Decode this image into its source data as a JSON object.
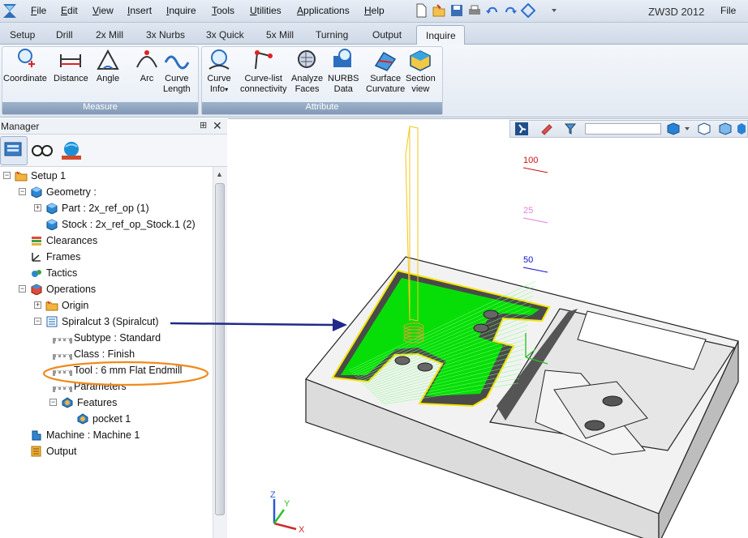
{
  "menubar": {
    "items": [
      {
        "label": "File",
        "u": "F",
        "rest": "ile"
      },
      {
        "label": "Edit",
        "u": "E",
        "rest": "dit"
      },
      {
        "label": "View",
        "u": "V",
        "rest": "iew"
      },
      {
        "label": "Insert",
        "u": "I",
        "rest": "nsert"
      },
      {
        "label": "Inquire",
        "u": "I",
        "rest": "nquire"
      },
      {
        "label": "Tools",
        "u": "T",
        "rest": "ools"
      },
      {
        "label": "Utilities",
        "u": "U",
        "rest": "tilities"
      },
      {
        "label": "Applications",
        "u": "A",
        "rest": "pplications"
      },
      {
        "label": "Help",
        "u": "H",
        "rest": "elp"
      }
    ],
    "app_title": "ZW3D 2012",
    "file_right": "File"
  },
  "tabs": [
    "Setup",
    "Drill",
    "2x Mill",
    "3x Nurbs",
    "3x Quick",
    "5x Mill",
    "Turning",
    "Output",
    "Inquire"
  ],
  "ribbon": {
    "groups": [
      {
        "label": "Measure",
        "buttons": [
          {
            "line1": "Coordinate",
            "line2": "",
            "icon": "coordinate-icon"
          },
          {
            "line1": "Distance",
            "line2": "",
            "icon": "distance-icon"
          },
          {
            "line1": "Angle",
            "line2": "",
            "icon": "angle-icon"
          },
          {
            "line1": "Arc",
            "line2": "",
            "icon": "arc-icon"
          },
          {
            "line1": "Curve",
            "line2": "Length",
            "icon": "curve-length-icon"
          }
        ]
      },
      {
        "label": "Attribute",
        "buttons": [
          {
            "line1": "Curve",
            "line2": "Info",
            "icon": "curve-info-icon",
            "dropdown": "▾"
          },
          {
            "line1": "Curve-list",
            "line2": "connectivity",
            "icon": "curve-list-icon"
          },
          {
            "line1": "Analyze",
            "line2": "Faces",
            "icon": "analyze-faces-icon"
          },
          {
            "line1": "NURBS",
            "line2": "Data",
            "icon": "nurbs-data-icon"
          },
          {
            "line1": "Surface",
            "line2": "Curvature",
            "icon": "surface-curvature-icon"
          },
          {
            "line1": "Section",
            "line2": "view",
            "icon": "section-view-icon"
          }
        ]
      }
    ]
  },
  "manager": {
    "title": "Manager",
    "pin": "⊞",
    "close": "✕",
    "tree": [
      {
        "label": "Setup 1"
      },
      {
        "label": "Geometry :"
      },
      {
        "label": "Part : 2x_ref_op (1)"
      },
      {
        "label": "Stock : 2x_ref_op_Stock.1 (2)"
      },
      {
        "label": "Clearances"
      },
      {
        "label": "Frames"
      },
      {
        "label": "Tactics"
      },
      {
        "label": "Operations"
      },
      {
        "label": "Origin"
      },
      {
        "label": "Spiralcut 3 (Spiralcut)"
      },
      {
        "label": "Subtype : Standard"
      },
      {
        "label": "Class : Finish"
      },
      {
        "label": "Tool : 6 mm Flat Endmill"
      },
      {
        "label": "Parameters"
      },
      {
        "label": "Features"
      },
      {
        "label": "pocket 1"
      },
      {
        "label": "Machine : Machine 1"
      },
      {
        "label": "Output"
      }
    ]
  },
  "viewport": {
    "dim_labels": [
      "100",
      "25",
      "50"
    ],
    "axis_labels": {
      "x": "X",
      "y": "Y",
      "z": "Z"
    }
  },
  "colors": {
    "toolpath": "#00ee00",
    "boundary": "#f5e600",
    "annotation_ellipse": "#f08a1c",
    "annotation_arrow": "#1f2a8a"
  }
}
